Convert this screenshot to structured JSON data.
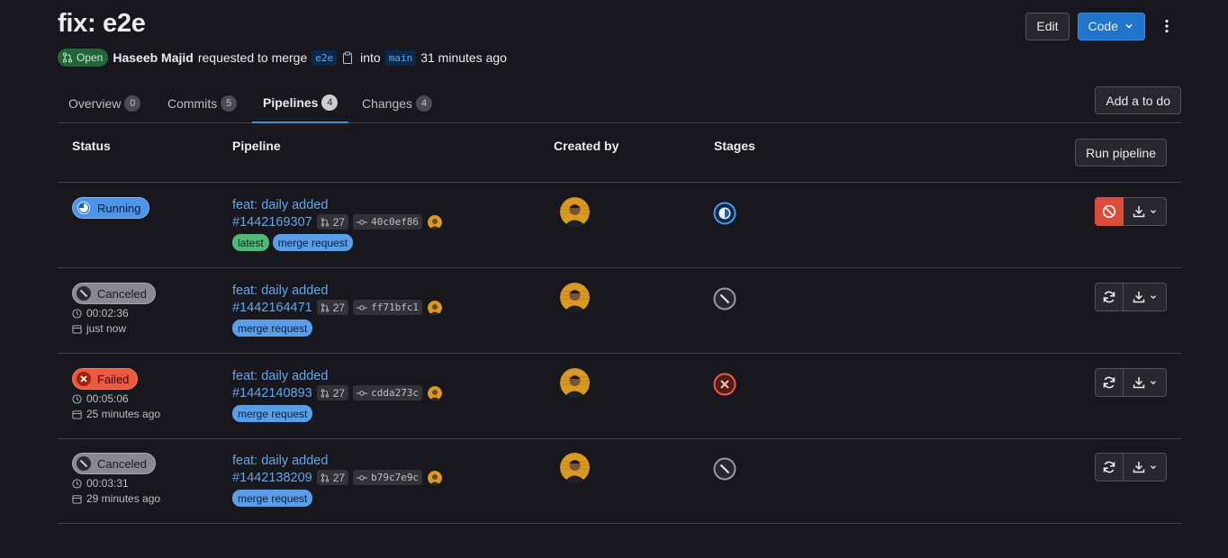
{
  "header": {
    "title": "fix: e2e",
    "edit_label": "Edit",
    "code_label": "Code",
    "status": "Open",
    "author": "Haseeb Majid",
    "requested_text": "requested to merge",
    "source_branch": "e2e",
    "into_text": "into",
    "target_branch": "main",
    "time": "31 minutes ago"
  },
  "tabs": [
    {
      "label": "Overview",
      "count": "0"
    },
    {
      "label": "Commits",
      "count": "5"
    },
    {
      "label": "Pipelines",
      "count": "4"
    },
    {
      "label": "Changes",
      "count": "4"
    }
  ],
  "todo_label": "Add a to do",
  "table": {
    "headers": {
      "status": "Status",
      "pipeline": "Pipeline",
      "created_by": "Created by",
      "stages": "Stages"
    },
    "run_pipeline_label": "Run pipeline"
  },
  "pipelines": [
    {
      "status": "Running",
      "duration": "",
      "finished": "",
      "title": "feat: daily added",
      "id": "#1442169307",
      "mr": "27",
      "sha": "40c0ef86",
      "tags": [
        "latest",
        "merge request"
      ]
    },
    {
      "status": "Canceled",
      "duration": "00:02:36",
      "finished": "just now",
      "title": "feat: daily added",
      "id": "#1442164471",
      "mr": "27",
      "sha": "ff71bfc1",
      "tags": [
        "merge request"
      ]
    },
    {
      "status": "Failed",
      "duration": "00:05:06",
      "finished": "25 minutes ago",
      "title": "feat: daily added",
      "id": "#1442140893",
      "mr": "27",
      "sha": "cdda273c",
      "tags": [
        "merge request"
      ]
    },
    {
      "status": "Canceled",
      "duration": "00:03:31",
      "finished": "29 minutes ago",
      "title": "feat: daily added",
      "id": "#1442138209",
      "mr": "27",
      "sha": "b79c7e9c",
      "tags": [
        "merge request"
      ]
    }
  ],
  "colors": {
    "background": "#18171d",
    "link": "#63a6e9",
    "primary": "#1f75cb",
    "running": "#4e94e8",
    "failed": "#ec5941",
    "canceled": "#8a898f"
  }
}
